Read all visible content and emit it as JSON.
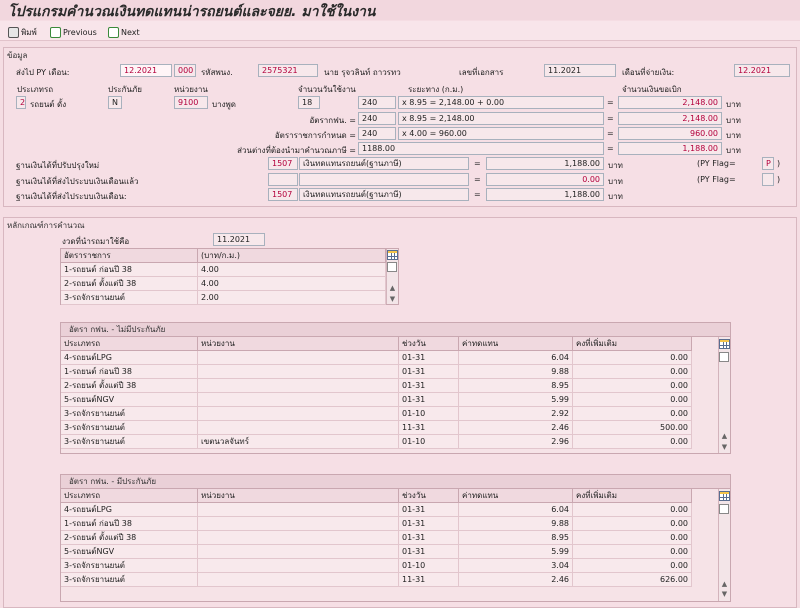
{
  "window": {
    "title": "โปรแกรมคำนวณเงินทดแทนน่ารถยนต์และจยย. มาใช้ในงาน"
  },
  "toolbar": {
    "print": "พิมพ์",
    "previous": "Previous",
    "next": "Next"
  },
  "info": {
    "section": "ข้อมูล",
    "send_py_month_label": "ส่งไป PY เดือน:",
    "send_py_month": "12.2021",
    "code": "000",
    "emp_id_label": "รหัสพนง.",
    "emp_id": "2575321",
    "emp_name": "นาย รุจวลินท์ ถาวรทว",
    "doc_no_label": "เลขที่เอกสาร",
    "doc_no": "11.2021",
    "pay_month_label": "เดือนที่จ่ายเงิน:",
    "pay_month": "12.2021",
    "col_vehicle_type": "ประเภทรถ",
    "col_insurance": "ประกันภัย",
    "col_unit": "หน่วยงาน",
    "col_days": "จำนวนวันใช้งาน",
    "col_distance": "ระยะทาง (ก.ม.)",
    "col_claim_amount": "จำนวนเงินขอเบิก",
    "vehicle_code": "2",
    "vehicle_name": "รถยนต์ ดั้ง",
    "insurance": "N",
    "unit_code": "9100",
    "unit_name": "บางพูด",
    "days": "18",
    "distance": "240",
    "formula_main": "x 8.95 = 2,148.00 + 0.00",
    "claim_total": "2,148.00",
    "baht": "บาท",
    "rate_company_label": "อัตรากฟน. =",
    "rate_company_dist": "240",
    "rate_company_formula": "x 8.95 = 2,148.00",
    "rate_company_amount": "2,148.00",
    "rate_fixed_label": "อัตราราชการกำหนด =",
    "rate_fixed_dist": "240",
    "rate_fixed_formula": "x 4.00 = 960.00",
    "rate_fixed_amount": "960.00",
    "diff_label": "ส่วนต่างที่ต้องนำมาคำนวณภาษี =",
    "diff_value": "1188.00",
    "diff_amount": "1,188.00",
    "eq": "=",
    "base_new_label": "ฐานเงินได้ที่ปรับปรุงใหม่",
    "base_new_code": "1507",
    "base_new_desc": "เงินทดแทนรถยนต์(ฐานภาษี)",
    "base_new_amount": "1,188.00",
    "py_flag_label": "(PY Flag=",
    "py_flag_value": "P",
    "close_paren": ")",
    "base_prev_label": "ฐานเงินได้ที่ส่งไประบบเงินเดือนแล้ว",
    "base_prev_amount": "0.00",
    "py_flag2_label": "(PY Flag=",
    "base_send_label": "ฐานเงินได้ที่ส่งไประบบเงินเดือน:",
    "base_send_code": "1507",
    "base_send_desc": "เงินทดแทนรถยนต์(ฐานภาษี)",
    "base_send_amount": "1,188.00"
  },
  "criteria": {
    "section": "หลักเกณฑ์การคำนวณ",
    "period_label": "งวดที่นำรถมาใช้คือ",
    "period": "11.2021",
    "gov_rates": {
      "headers": [
        "อัตราราชการ",
        "(บาท/ก.ม.)"
      ],
      "rows": [
        [
          "1-รถยนต์ ก่อนปี 38",
          "4.00"
        ],
        [
          "2-รถยนต์ ตั้งแต่ปี 38",
          "4.00"
        ],
        [
          "3-รถจักรยานยนต์",
          "2.00"
        ]
      ]
    },
    "uninsured": {
      "title": "อัตรา กฟน. - ไม่มีประกันภัย",
      "headers": [
        "ประเภทรถ",
        "หน่วยงาน",
        "ช่วงวัน",
        "ค่าทดแทน",
        "คงที่เพิ่มเติม"
      ],
      "rows": [
        [
          "4-รถยนต์LPG",
          "",
          "01-31",
          "6.04",
          "0.00"
        ],
        [
          "1-รถยนต์ ก่อนปี 38",
          "",
          "01-31",
          "9.88",
          "0.00"
        ],
        [
          "2-รถยนต์ ตั้งแต่ปี 38",
          "",
          "01-31",
          "8.95",
          "0.00"
        ],
        [
          "5-รถยนต์NGV",
          "",
          "01-31",
          "5.99",
          "0.00"
        ],
        [
          "3-รถจักรยานยนต์",
          "",
          "01-10",
          "2.92",
          "0.00"
        ],
        [
          "3-รถจักรยานยนต์",
          "",
          "11-31",
          "2.46",
          "500.00"
        ],
        [
          "3-รถจักรยานยนต์",
          "เขตนวลจันทร์",
          "01-10",
          "2.96",
          "0.00"
        ]
      ]
    },
    "insured": {
      "title": "อัตรา กฟน. - มีประกันภัย",
      "headers": [
        "ประเภทรถ",
        "หน่วยงาน",
        "ช่วงวัน",
        "ค่าทดแทน",
        "คงที่เพิ่มเติม"
      ],
      "rows": [
        [
          "4-รถยนต์LPG",
          "",
          "01-31",
          "6.04",
          "0.00"
        ],
        [
          "1-รถยนต์ ก่อนปี 38",
          "",
          "01-31",
          "9.88",
          "0.00"
        ],
        [
          "2-รถยนต์ ตั้งแต่ปี 38",
          "",
          "01-31",
          "8.95",
          "0.00"
        ],
        [
          "5-รถยนต์NGV",
          "",
          "01-31",
          "5.99",
          "0.00"
        ],
        [
          "3-รถจักรยานยนต์",
          "",
          "01-10",
          "3.04",
          "0.00"
        ],
        [
          "3-รถจักรยานยนต์",
          "",
          "11-31",
          "2.46",
          "626.00"
        ]
      ]
    }
  }
}
